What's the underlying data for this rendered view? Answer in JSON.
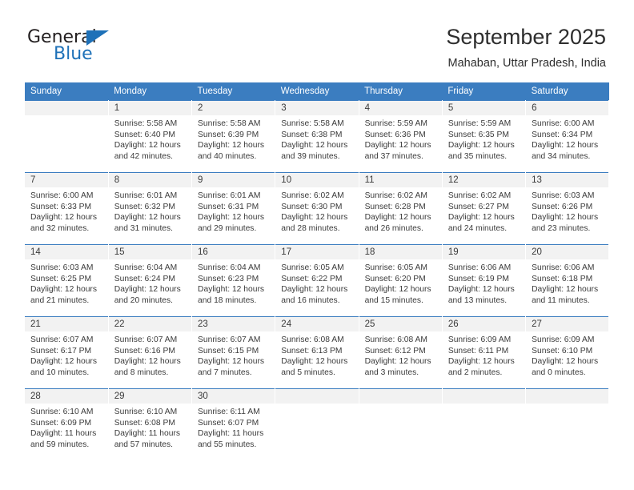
{
  "brand": {
    "name_top": "General",
    "name_bottom": "Blue",
    "triangle_color": "#1e71b8"
  },
  "header": {
    "title": "September 2025",
    "subtitle": "Mahaban, Uttar Pradesh, India"
  },
  "theme": {
    "header_blue": "#3b7dc0",
    "daynum_bg": "#f2f2f2",
    "text": "#3a3a3a"
  },
  "weekdays": [
    "Sunday",
    "Monday",
    "Tuesday",
    "Wednesday",
    "Thursday",
    "Friday",
    "Saturday"
  ],
  "weeks": [
    [
      {
        "day": "",
        "lines": []
      },
      {
        "day": "1",
        "lines": [
          "Sunrise: 5:58 AM",
          "Sunset: 6:40 PM",
          "Daylight: 12 hours and 42 minutes."
        ]
      },
      {
        "day": "2",
        "lines": [
          "Sunrise: 5:58 AM",
          "Sunset: 6:39 PM",
          "Daylight: 12 hours and 40 minutes."
        ]
      },
      {
        "day": "3",
        "lines": [
          "Sunrise: 5:58 AM",
          "Sunset: 6:38 PM",
          "Daylight: 12 hours and 39 minutes."
        ]
      },
      {
        "day": "4",
        "lines": [
          "Sunrise: 5:59 AM",
          "Sunset: 6:36 PM",
          "Daylight: 12 hours and 37 minutes."
        ]
      },
      {
        "day": "5",
        "lines": [
          "Sunrise: 5:59 AM",
          "Sunset: 6:35 PM",
          "Daylight: 12 hours and 35 minutes."
        ]
      },
      {
        "day": "6",
        "lines": [
          "Sunrise: 6:00 AM",
          "Sunset: 6:34 PM",
          "Daylight: 12 hours and 34 minutes."
        ]
      }
    ],
    [
      {
        "day": "7",
        "lines": [
          "Sunrise: 6:00 AM",
          "Sunset: 6:33 PM",
          "Daylight: 12 hours and 32 minutes."
        ]
      },
      {
        "day": "8",
        "lines": [
          "Sunrise: 6:01 AM",
          "Sunset: 6:32 PM",
          "Daylight: 12 hours and 31 minutes."
        ]
      },
      {
        "day": "9",
        "lines": [
          "Sunrise: 6:01 AM",
          "Sunset: 6:31 PM",
          "Daylight: 12 hours and 29 minutes."
        ]
      },
      {
        "day": "10",
        "lines": [
          "Sunrise: 6:02 AM",
          "Sunset: 6:30 PM",
          "Daylight: 12 hours and 28 minutes."
        ]
      },
      {
        "day": "11",
        "lines": [
          "Sunrise: 6:02 AM",
          "Sunset: 6:28 PM",
          "Daylight: 12 hours and 26 minutes."
        ]
      },
      {
        "day": "12",
        "lines": [
          "Sunrise: 6:02 AM",
          "Sunset: 6:27 PM",
          "Daylight: 12 hours and 24 minutes."
        ]
      },
      {
        "day": "13",
        "lines": [
          "Sunrise: 6:03 AM",
          "Sunset: 6:26 PM",
          "Daylight: 12 hours and 23 minutes."
        ]
      }
    ],
    [
      {
        "day": "14",
        "lines": [
          "Sunrise: 6:03 AM",
          "Sunset: 6:25 PM",
          "Daylight: 12 hours and 21 minutes."
        ]
      },
      {
        "day": "15",
        "lines": [
          "Sunrise: 6:04 AM",
          "Sunset: 6:24 PM",
          "Daylight: 12 hours and 20 minutes."
        ]
      },
      {
        "day": "16",
        "lines": [
          "Sunrise: 6:04 AM",
          "Sunset: 6:23 PM",
          "Daylight: 12 hours and 18 minutes."
        ]
      },
      {
        "day": "17",
        "lines": [
          "Sunrise: 6:05 AM",
          "Sunset: 6:22 PM",
          "Daylight: 12 hours and 16 minutes."
        ]
      },
      {
        "day": "18",
        "lines": [
          "Sunrise: 6:05 AM",
          "Sunset: 6:20 PM",
          "Daylight: 12 hours and 15 minutes."
        ]
      },
      {
        "day": "19",
        "lines": [
          "Sunrise: 6:06 AM",
          "Sunset: 6:19 PM",
          "Daylight: 12 hours and 13 minutes."
        ]
      },
      {
        "day": "20",
        "lines": [
          "Sunrise: 6:06 AM",
          "Sunset: 6:18 PM",
          "Daylight: 12 hours and 11 minutes."
        ]
      }
    ],
    [
      {
        "day": "21",
        "lines": [
          "Sunrise: 6:07 AM",
          "Sunset: 6:17 PM",
          "Daylight: 12 hours and 10 minutes."
        ]
      },
      {
        "day": "22",
        "lines": [
          "Sunrise: 6:07 AM",
          "Sunset: 6:16 PM",
          "Daylight: 12 hours and 8 minutes."
        ]
      },
      {
        "day": "23",
        "lines": [
          "Sunrise: 6:07 AM",
          "Sunset: 6:15 PM",
          "Daylight: 12 hours and 7 minutes."
        ]
      },
      {
        "day": "24",
        "lines": [
          "Sunrise: 6:08 AM",
          "Sunset: 6:13 PM",
          "Daylight: 12 hours and 5 minutes."
        ]
      },
      {
        "day": "25",
        "lines": [
          "Sunrise: 6:08 AM",
          "Sunset: 6:12 PM",
          "Daylight: 12 hours and 3 minutes."
        ]
      },
      {
        "day": "26",
        "lines": [
          "Sunrise: 6:09 AM",
          "Sunset: 6:11 PM",
          "Daylight: 12 hours and 2 minutes."
        ]
      },
      {
        "day": "27",
        "lines": [
          "Sunrise: 6:09 AM",
          "Sunset: 6:10 PM",
          "Daylight: 12 hours and 0 minutes."
        ]
      }
    ],
    [
      {
        "day": "28",
        "lines": [
          "Sunrise: 6:10 AM",
          "Sunset: 6:09 PM",
          "Daylight: 11 hours and 59 minutes."
        ]
      },
      {
        "day": "29",
        "lines": [
          "Sunrise: 6:10 AM",
          "Sunset: 6:08 PM",
          "Daylight: 11 hours and 57 minutes."
        ]
      },
      {
        "day": "30",
        "lines": [
          "Sunrise: 6:11 AM",
          "Sunset: 6:07 PM",
          "Daylight: 11 hours and 55 minutes."
        ]
      },
      {
        "day": "",
        "lines": []
      },
      {
        "day": "",
        "lines": []
      },
      {
        "day": "",
        "lines": []
      },
      {
        "day": "",
        "lines": []
      }
    ]
  ]
}
